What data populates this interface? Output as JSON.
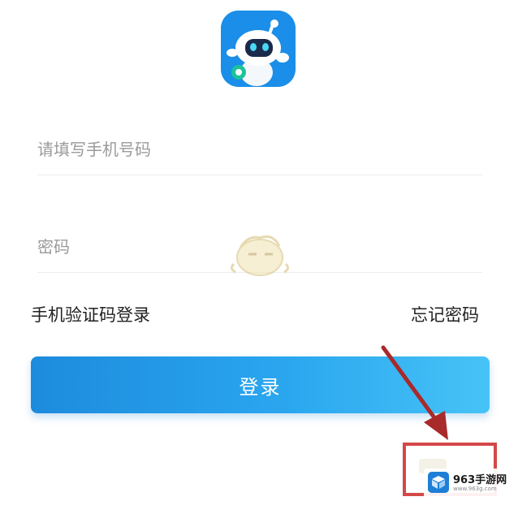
{
  "app": {
    "icon": "robot-mascot-app-icon",
    "brand_color": "#1a8ee8"
  },
  "form": {
    "phone_placeholder": "请填写手机号码",
    "phone_value": "",
    "password_placeholder": "密码",
    "password_value": ""
  },
  "links": {
    "sms_login": "手机验证码登录",
    "forgot_password": "忘记密码"
  },
  "login_button": {
    "label": "登录",
    "gradient_start": "#1d8bdc",
    "gradient_end": "#46c3f6"
  },
  "annotation": {
    "arrow_color": "#a82a2a",
    "box_color": "#d44848"
  },
  "watermark": {
    "name": "963手游网",
    "url": "www.963g.com"
  }
}
